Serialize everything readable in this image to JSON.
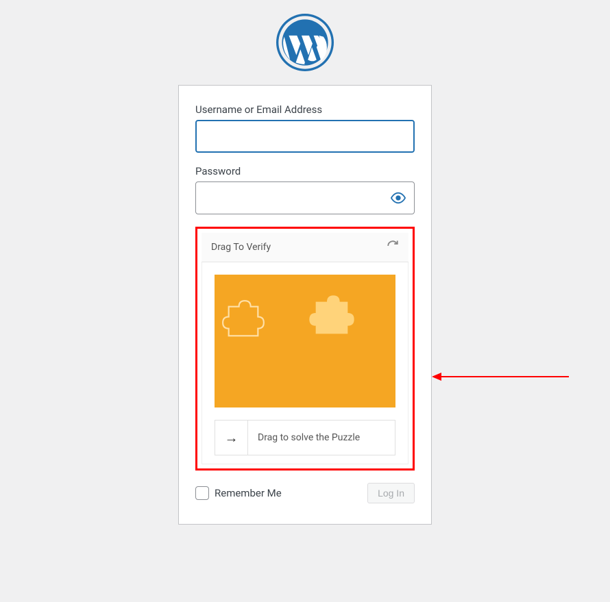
{
  "labels": {
    "username": "Username or Email Address",
    "password": "Password",
    "remember": "Remember Me"
  },
  "values": {
    "username": "",
    "password": ""
  },
  "captcha": {
    "title": "Drag To Verify",
    "slider_text": "Drag to solve the Puzzle",
    "handle_glyph": "→",
    "image_bg": "#f5a623"
  },
  "buttons": {
    "login": "Log In"
  },
  "annotation": {
    "arrow_color": "#ff0000"
  }
}
